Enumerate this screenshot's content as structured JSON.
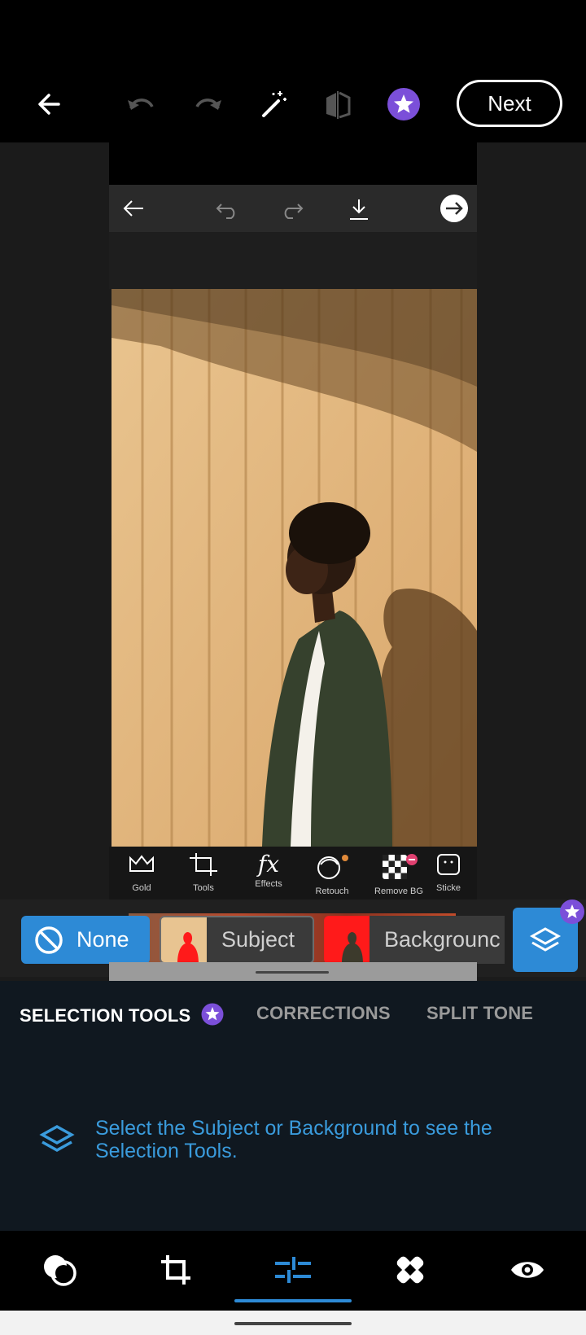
{
  "topbar": {
    "next_label": "Next",
    "icons": [
      "back-arrow-icon",
      "undo-icon",
      "redo-icon",
      "magic-wand-icon",
      "compare-icon",
      "premium-star-icon"
    ]
  },
  "inner_app": {
    "toolbar_icons": [
      "back-arrow-icon",
      "undo-icon",
      "redo-icon",
      "download-icon",
      "forward-circle-icon"
    ],
    "tools": [
      {
        "label": "Gold",
        "icon": "crown-icon"
      },
      {
        "label": "Tools",
        "icon": "crop-icon"
      },
      {
        "label": "Effects",
        "icon": "fx-icon"
      },
      {
        "label": "Retouch",
        "icon": "face-retouch-icon"
      },
      {
        "label": "Remove BG",
        "icon": "checkerboard-icon"
      },
      {
        "label": "Sticke",
        "icon": "sticker-icon"
      }
    ]
  },
  "selection": {
    "none_label": "None",
    "subject_label": "Subject",
    "background_label": "Backgrounc"
  },
  "tabs": [
    {
      "label": "SELECTION TOOLS",
      "active": true
    },
    {
      "label": "CORRECTIONS",
      "active": false
    },
    {
      "label": "SPLIT TONE",
      "active": false
    }
  ],
  "hint": "Select the Subject or Background to see the Selection Tools.",
  "bottom_nav": [
    "looks-icon",
    "crop-icon",
    "adjust-sliders-icon",
    "healing-icon",
    "eye-icon"
  ],
  "colors": {
    "accent": "#2d8ad6",
    "premium": "#7b4fd9",
    "hint_text": "#3a9bdc"
  }
}
